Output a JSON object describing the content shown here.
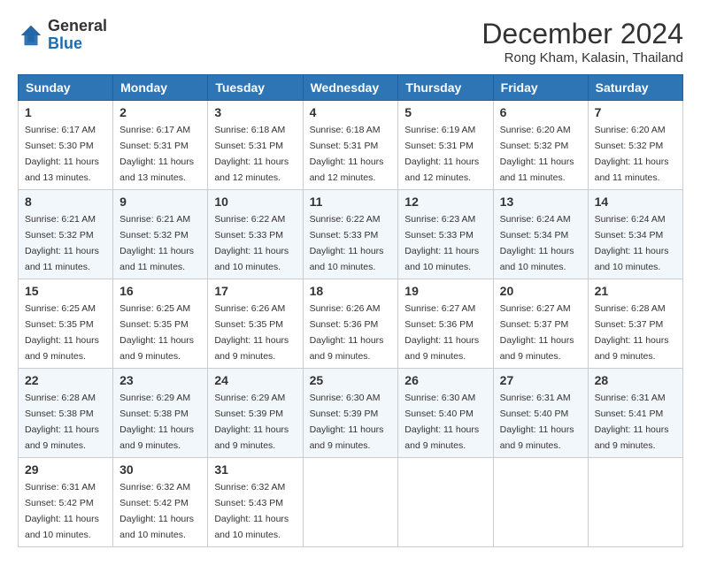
{
  "header": {
    "logo_line1": "General",
    "logo_line2": "Blue",
    "month": "December 2024",
    "location": "Rong Kham, Kalasin, Thailand"
  },
  "weekdays": [
    "Sunday",
    "Monday",
    "Tuesday",
    "Wednesday",
    "Thursday",
    "Friday",
    "Saturday"
  ],
  "weeks": [
    [
      {
        "day": "1",
        "sunrise": "6:17 AM",
        "sunset": "5:30 PM",
        "daylight": "11 hours and 13 minutes."
      },
      {
        "day": "2",
        "sunrise": "6:17 AM",
        "sunset": "5:31 PM",
        "daylight": "11 hours and 13 minutes."
      },
      {
        "day": "3",
        "sunrise": "6:18 AM",
        "sunset": "5:31 PM",
        "daylight": "11 hours and 12 minutes."
      },
      {
        "day": "4",
        "sunrise": "6:18 AM",
        "sunset": "5:31 PM",
        "daylight": "11 hours and 12 minutes."
      },
      {
        "day": "5",
        "sunrise": "6:19 AM",
        "sunset": "5:31 PM",
        "daylight": "11 hours and 12 minutes."
      },
      {
        "day": "6",
        "sunrise": "6:20 AM",
        "sunset": "5:32 PM",
        "daylight": "11 hours and 11 minutes."
      },
      {
        "day": "7",
        "sunrise": "6:20 AM",
        "sunset": "5:32 PM",
        "daylight": "11 hours and 11 minutes."
      }
    ],
    [
      {
        "day": "8",
        "sunrise": "6:21 AM",
        "sunset": "5:32 PM",
        "daylight": "11 hours and 11 minutes."
      },
      {
        "day": "9",
        "sunrise": "6:21 AM",
        "sunset": "5:32 PM",
        "daylight": "11 hours and 11 minutes."
      },
      {
        "day": "10",
        "sunrise": "6:22 AM",
        "sunset": "5:33 PM",
        "daylight": "11 hours and 10 minutes."
      },
      {
        "day": "11",
        "sunrise": "6:22 AM",
        "sunset": "5:33 PM",
        "daylight": "11 hours and 10 minutes."
      },
      {
        "day": "12",
        "sunrise": "6:23 AM",
        "sunset": "5:33 PM",
        "daylight": "11 hours and 10 minutes."
      },
      {
        "day": "13",
        "sunrise": "6:24 AM",
        "sunset": "5:34 PM",
        "daylight": "11 hours and 10 minutes."
      },
      {
        "day": "14",
        "sunrise": "6:24 AM",
        "sunset": "5:34 PM",
        "daylight": "11 hours and 10 minutes."
      }
    ],
    [
      {
        "day": "15",
        "sunrise": "6:25 AM",
        "sunset": "5:35 PM",
        "daylight": "11 hours and 9 minutes."
      },
      {
        "day": "16",
        "sunrise": "6:25 AM",
        "sunset": "5:35 PM",
        "daylight": "11 hours and 9 minutes."
      },
      {
        "day": "17",
        "sunrise": "6:26 AM",
        "sunset": "5:35 PM",
        "daylight": "11 hours and 9 minutes."
      },
      {
        "day": "18",
        "sunrise": "6:26 AM",
        "sunset": "5:36 PM",
        "daylight": "11 hours and 9 minutes."
      },
      {
        "day": "19",
        "sunrise": "6:27 AM",
        "sunset": "5:36 PM",
        "daylight": "11 hours and 9 minutes."
      },
      {
        "day": "20",
        "sunrise": "6:27 AM",
        "sunset": "5:37 PM",
        "daylight": "11 hours and 9 minutes."
      },
      {
        "day": "21",
        "sunrise": "6:28 AM",
        "sunset": "5:37 PM",
        "daylight": "11 hours and 9 minutes."
      }
    ],
    [
      {
        "day": "22",
        "sunrise": "6:28 AM",
        "sunset": "5:38 PM",
        "daylight": "11 hours and 9 minutes."
      },
      {
        "day": "23",
        "sunrise": "6:29 AM",
        "sunset": "5:38 PM",
        "daylight": "11 hours and 9 minutes."
      },
      {
        "day": "24",
        "sunrise": "6:29 AM",
        "sunset": "5:39 PM",
        "daylight": "11 hours and 9 minutes."
      },
      {
        "day": "25",
        "sunrise": "6:30 AM",
        "sunset": "5:39 PM",
        "daylight": "11 hours and 9 minutes."
      },
      {
        "day": "26",
        "sunrise": "6:30 AM",
        "sunset": "5:40 PM",
        "daylight": "11 hours and 9 minutes."
      },
      {
        "day": "27",
        "sunrise": "6:31 AM",
        "sunset": "5:40 PM",
        "daylight": "11 hours and 9 minutes."
      },
      {
        "day": "28",
        "sunrise": "6:31 AM",
        "sunset": "5:41 PM",
        "daylight": "11 hours and 9 minutes."
      }
    ],
    [
      {
        "day": "29",
        "sunrise": "6:31 AM",
        "sunset": "5:42 PM",
        "daylight": "11 hours and 10 minutes."
      },
      {
        "day": "30",
        "sunrise": "6:32 AM",
        "sunset": "5:42 PM",
        "daylight": "11 hours and 10 minutes."
      },
      {
        "day": "31",
        "sunrise": "6:32 AM",
        "sunset": "5:43 PM",
        "daylight": "11 hours and 10 minutes."
      },
      null,
      null,
      null,
      null
    ]
  ],
  "labels": {
    "sunrise": "Sunrise: ",
    "sunset": "Sunset: ",
    "daylight": "Daylight: "
  }
}
